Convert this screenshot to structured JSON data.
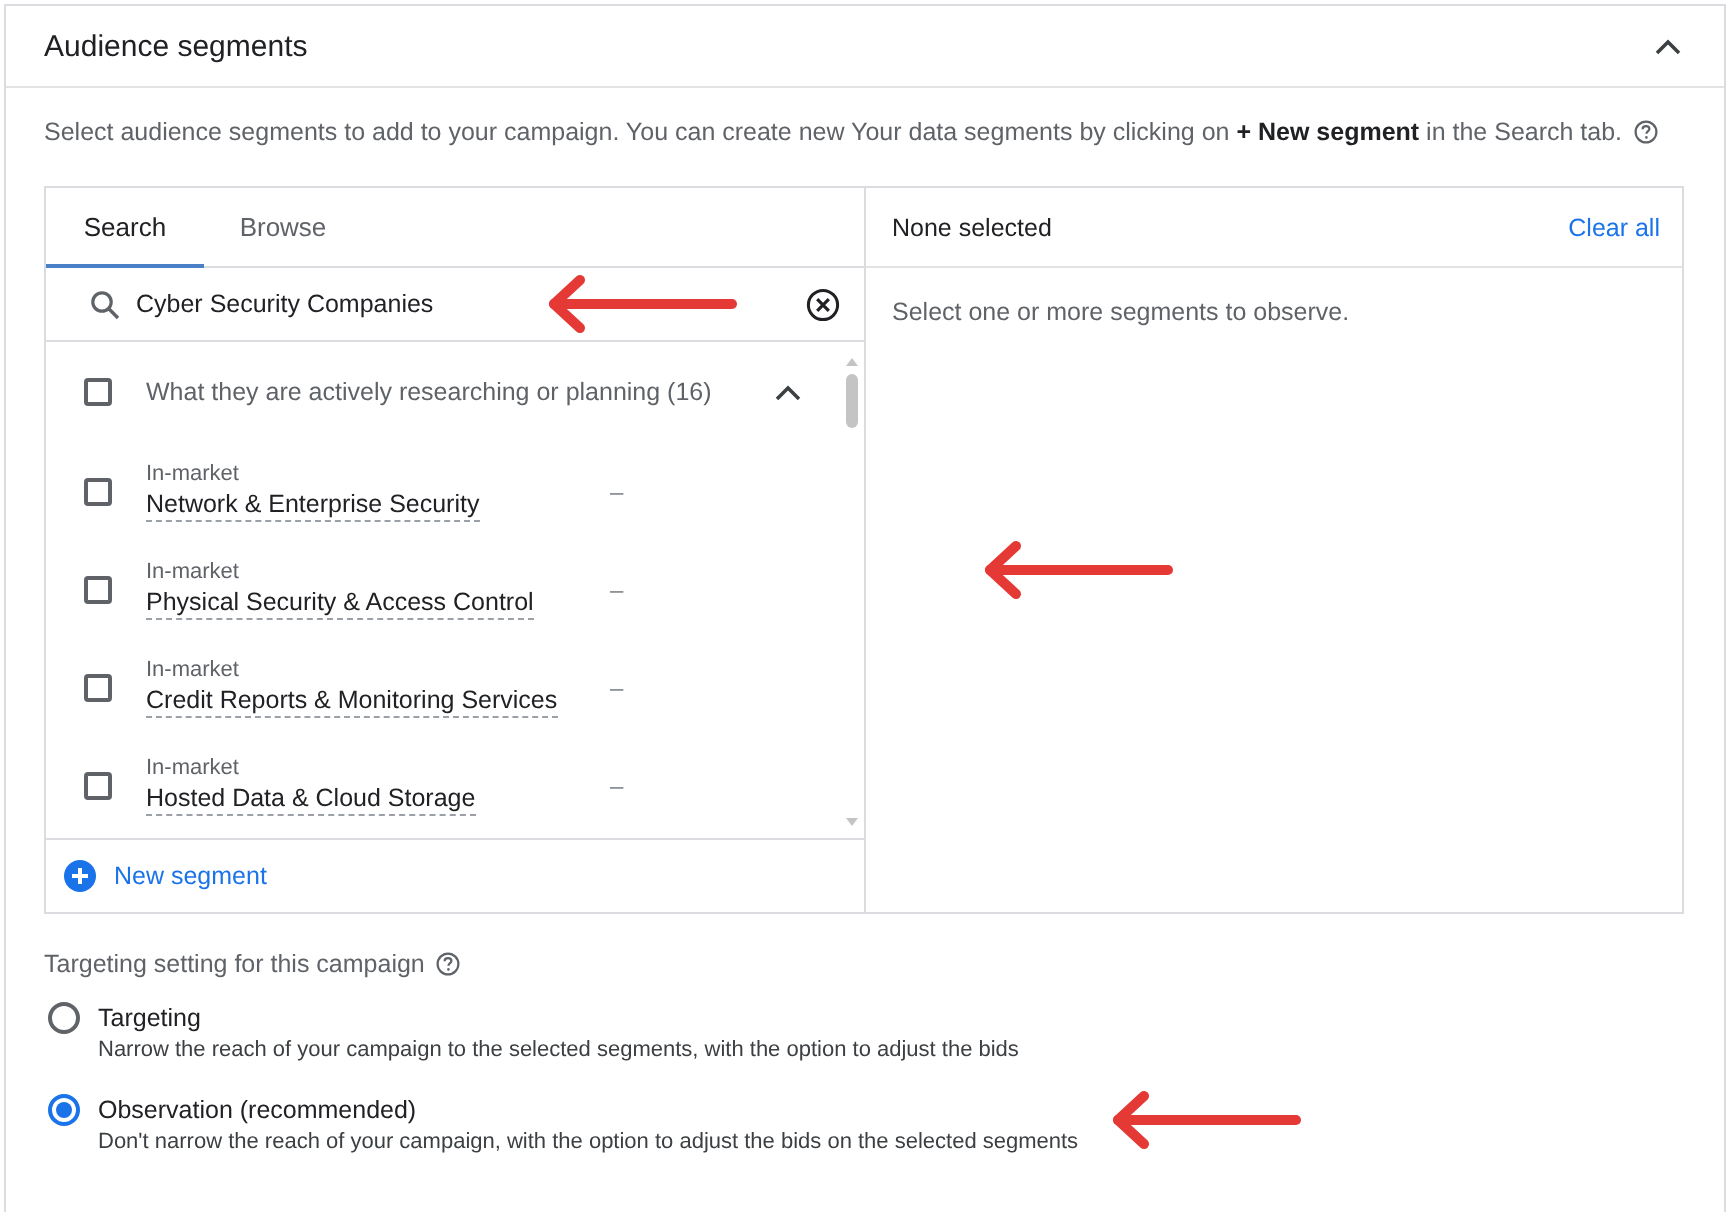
{
  "header": {
    "title": "Audience segments",
    "expanded": true
  },
  "description": "Select audience segments to add to your campaign. You can create new Your data segments by clicking on **+ New segment** in the Search tab.",
  "picker": {
    "tabs": [
      {
        "label": "Search",
        "selected": true
      },
      {
        "label": "Browse",
        "selected": false
      }
    ],
    "search": {
      "value": "Cyber Security Companies"
    },
    "group": {
      "label": "What they are actively researching or planning (16)",
      "checked": false,
      "expanded": true
    },
    "segments": [
      {
        "type": "In-market",
        "name": "Network & Enterprise Security",
        "value": "–",
        "checked": false
      },
      {
        "type": "In-market",
        "name": "Physical Security & Access Control",
        "value": "–",
        "checked": false
      },
      {
        "type": "In-market",
        "name": "Credit Reports & Monitoring Services",
        "value": "–",
        "checked": false
      },
      {
        "type": "In-market",
        "name": "Hosted Data & Cloud Storage",
        "value": "–",
        "checked": false
      }
    ],
    "new_segment": "New segment"
  },
  "selection": {
    "title": "None selected",
    "clear": "Clear all",
    "empty_text": "Select one or more segments to observe."
  },
  "targeting": {
    "title": "Targeting setting for this campaign",
    "options": [
      {
        "label": "Targeting",
        "description": "Narrow the reach of your campaign to the selected segments, with the option to adjust the bids",
        "selected": false
      },
      {
        "label": "Observation (recommended)",
        "description": "Don't narrow the reach of your campaign, with the option to adjust the bids on the selected segments",
        "selected": true
      }
    ]
  }
}
